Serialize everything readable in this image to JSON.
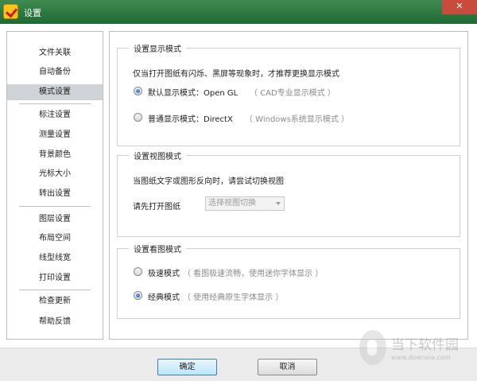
{
  "window": {
    "title": "设置",
    "close_symbol": "✕"
  },
  "sidebar": {
    "items": [
      {
        "label": "文件关联",
        "active": false
      },
      {
        "label": "自动备份",
        "active": false
      },
      {
        "label": "模式设置",
        "active": true
      },
      {
        "label": "标注设置",
        "active": false
      },
      {
        "label": "测量设置",
        "active": false
      },
      {
        "label": "背景颜色",
        "active": false
      },
      {
        "label": "光标大小",
        "active": false
      },
      {
        "label": "转出设置",
        "active": false
      },
      {
        "label": "图层设置",
        "active": false
      },
      {
        "label": "布局空间",
        "active": false
      },
      {
        "label": "线型线宽",
        "active": false
      },
      {
        "label": "打印设置",
        "active": false
      },
      {
        "label": "检查更新",
        "active": false
      },
      {
        "label": "帮助反馈",
        "active": false
      }
    ]
  },
  "display_mode": {
    "title": "设置显示模式",
    "hint": "仅当打开图纸有闪烁、黑屏等现象时，才推荐更换显示模式",
    "opengl_label": "默认显示模式：Open GL",
    "opengl_note": "（ CAD专业显示模式 ）",
    "opengl_selected": true,
    "directx_label": "普通显示模式：DirectX",
    "directx_note": "（ Windows系统显示模式 ）",
    "directx_selected": false
  },
  "view_mode": {
    "title": "设置视图模式",
    "hint": "当图纸文字或图形反向时，请尝试切换视图",
    "open_label": "请先打开图纸",
    "select_value": "选择视图切换"
  },
  "reading_mode": {
    "title": "设置看图模式",
    "fast_label": "极速模式",
    "fast_note": "（ 看图极速流畅，使用迷你字体显示 ）",
    "fast_selected": false,
    "classic_label": "经典模式",
    "classic_note": "（ 使用经典原生字体显示 ）",
    "classic_selected": true
  },
  "buttons": {
    "ok": "确定",
    "cancel": "取消"
  },
  "watermark": {
    "text": "当下软件园",
    "url": "www.downxia.com"
  }
}
